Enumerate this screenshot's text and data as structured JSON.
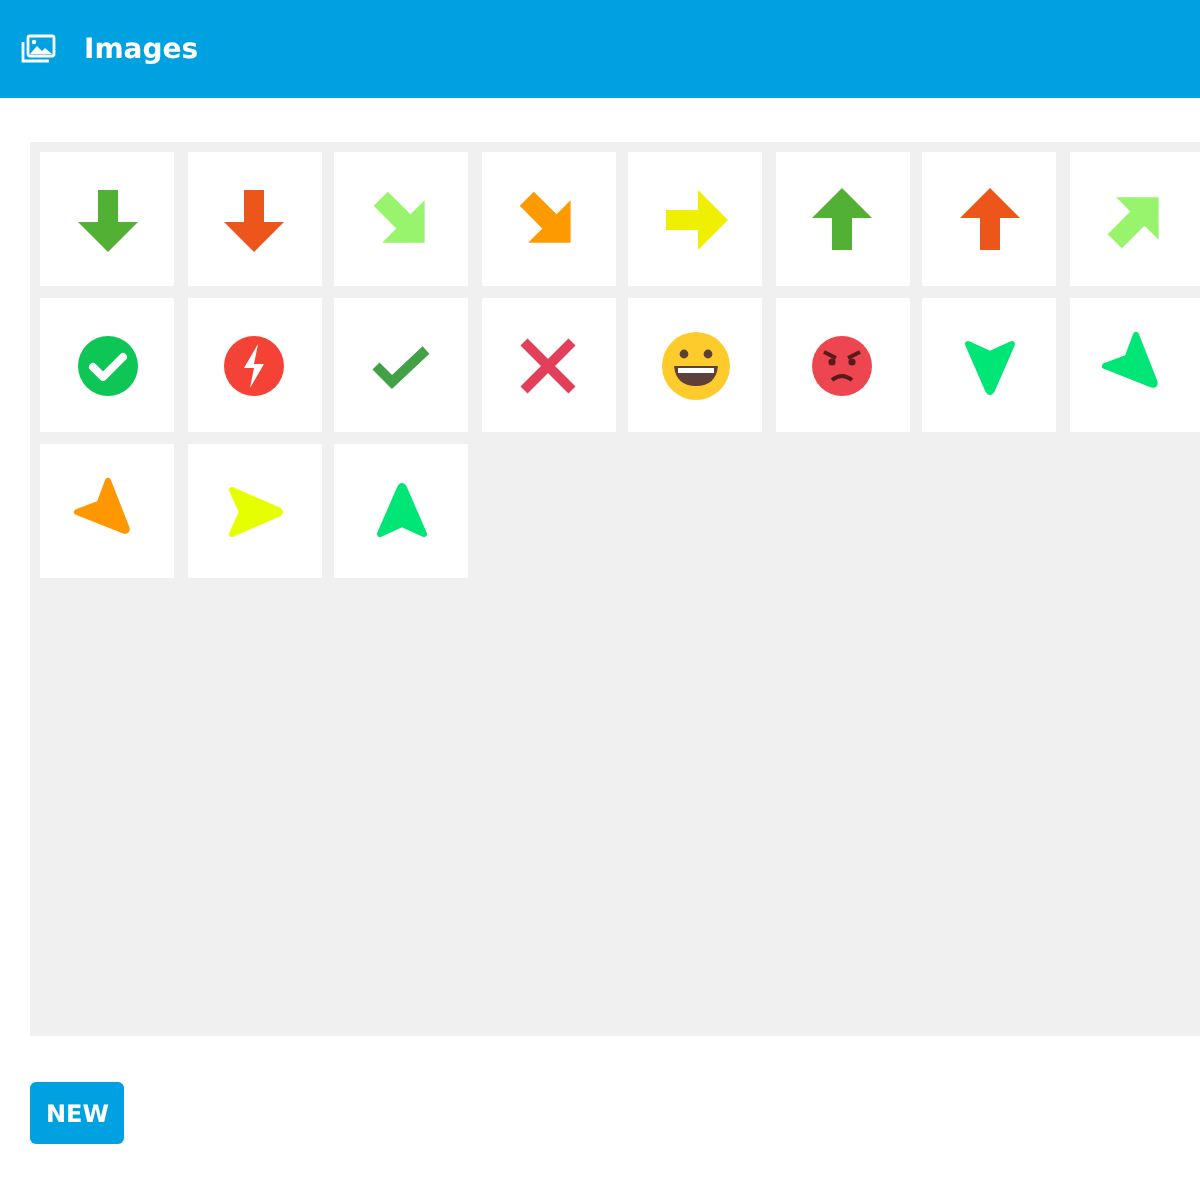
{
  "header": {
    "title": "Images"
  },
  "images": [
    {
      "kind": "arrow-down",
      "color": "#52b035"
    },
    {
      "kind": "arrow-down",
      "color": "#ec561b"
    },
    {
      "kind": "arrow-down-right",
      "color": "#98f46c"
    },
    {
      "kind": "arrow-down-right",
      "color": "#fc9a00"
    },
    {
      "kind": "arrow-right",
      "color": "#eef000"
    },
    {
      "kind": "arrow-up",
      "color": "#52b035"
    },
    {
      "kind": "arrow-up",
      "color": "#ec561b"
    },
    {
      "kind": "arrow-up-right",
      "color": "#98f46c"
    },
    {
      "kind": "check-circle",
      "color": "#0dc656"
    },
    {
      "kind": "bolt-circle",
      "color": "#f44336"
    },
    {
      "kind": "check",
      "color": "#43a047"
    },
    {
      "kind": "cross",
      "color": "#e23f5b"
    },
    {
      "kind": "smile",
      "color": "#fdcc2c"
    },
    {
      "kind": "angry",
      "color": "#ee4651"
    },
    {
      "kind": "chevron-down",
      "color": "#00e676"
    },
    {
      "kind": "chevron-down-right",
      "color": "#00e676"
    },
    {
      "kind": "chevron-down-right",
      "color": "#ff9800"
    },
    {
      "kind": "chevron-right",
      "color": "#e6ff00"
    },
    {
      "kind": "chevron-up",
      "color": "#00e676"
    }
  ],
  "button": {
    "label": "NEW"
  }
}
